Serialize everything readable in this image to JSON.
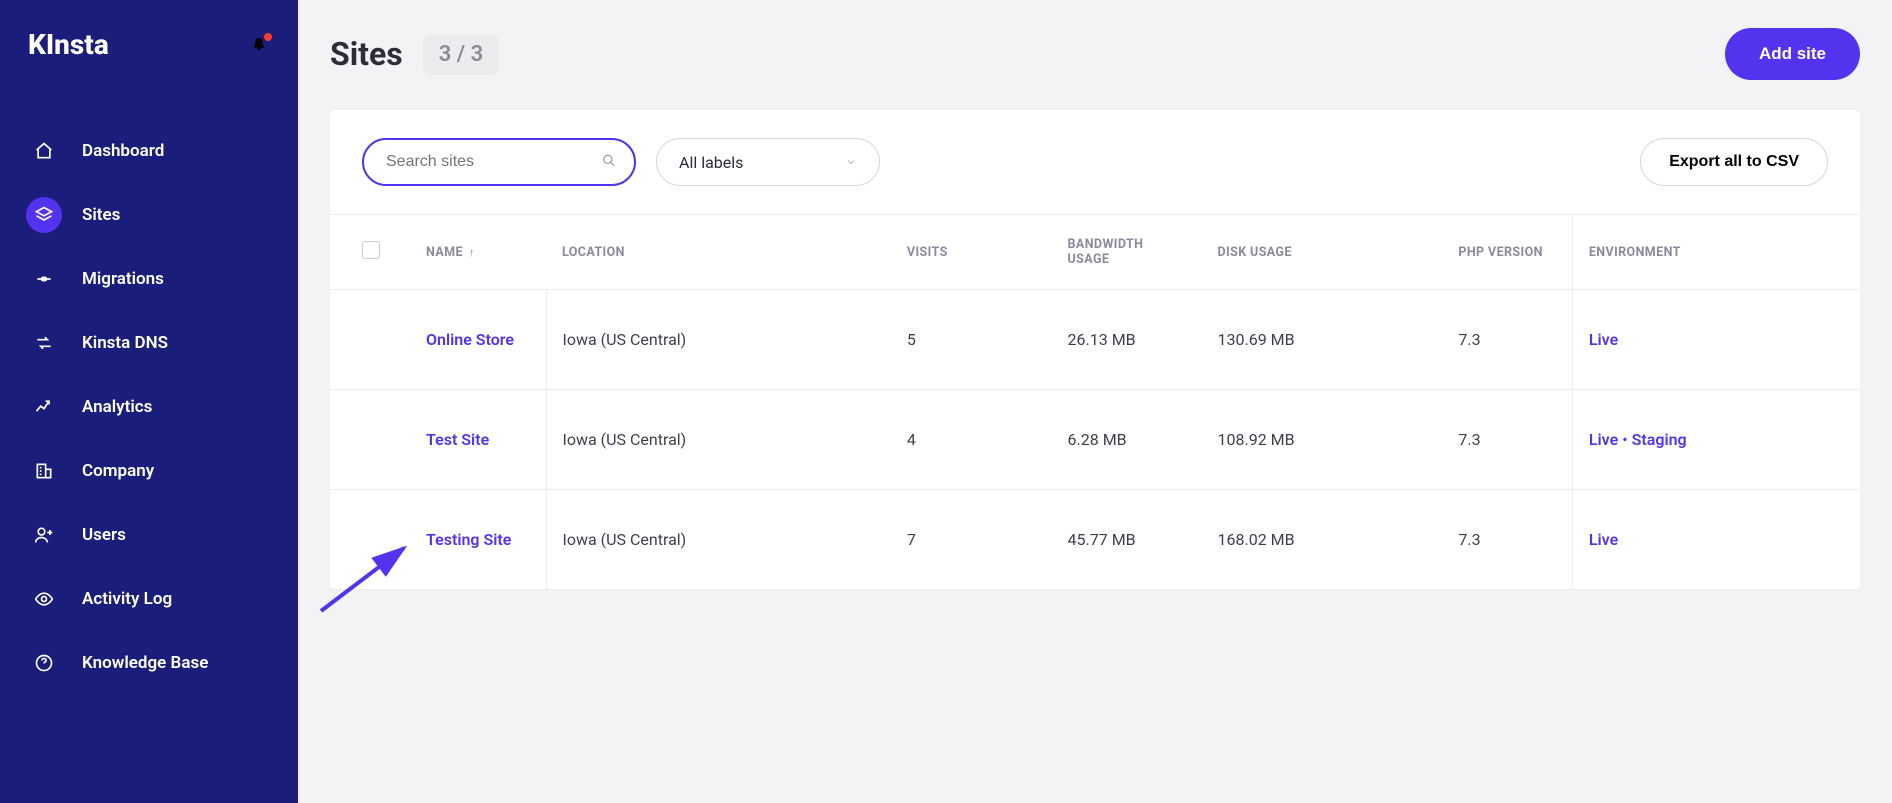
{
  "brand": "KInsta",
  "sidebar": {
    "items": [
      {
        "label": "Dashboard"
      },
      {
        "label": "Sites"
      },
      {
        "label": "Migrations"
      },
      {
        "label": "Kinsta DNS"
      },
      {
        "label": "Analytics"
      },
      {
        "label": "Company"
      },
      {
        "label": "Users"
      },
      {
        "label": "Activity Log"
      },
      {
        "label": "Knowledge Base"
      }
    ]
  },
  "page": {
    "title": "Sites",
    "count": "3 / 3",
    "add_label": "Add site"
  },
  "toolbar": {
    "search_placeholder": "Search sites",
    "labels_value": "All labels",
    "export_label": "Export all to CSV"
  },
  "table": {
    "headers": {
      "name": "NAME",
      "location": "LOCATION",
      "visits": "VISITS",
      "bandwidth": "BANDWIDTH USAGE",
      "disk": "DISK USAGE",
      "php": "PHP VERSION",
      "env": "ENVIRONMENT"
    },
    "rows": [
      {
        "name": "Online Store",
        "location": "Iowa (US Central)",
        "visits": "5",
        "bandwidth": "26.13 MB",
        "disk": "130.69 MB",
        "php": "7.3",
        "env": [
          "Live"
        ]
      },
      {
        "name": "Test Site",
        "location": "Iowa (US Central)",
        "visits": "4",
        "bandwidth": "6.28 MB",
        "disk": "108.92 MB",
        "php": "7.3",
        "env": [
          "Live",
          "Staging"
        ]
      },
      {
        "name": "Testing Site",
        "location": "Iowa (US Central)",
        "visits": "7",
        "bandwidth": "45.77 MB",
        "disk": "168.02 MB",
        "php": "7.3",
        "env": [
          "Live"
        ]
      }
    ]
  }
}
